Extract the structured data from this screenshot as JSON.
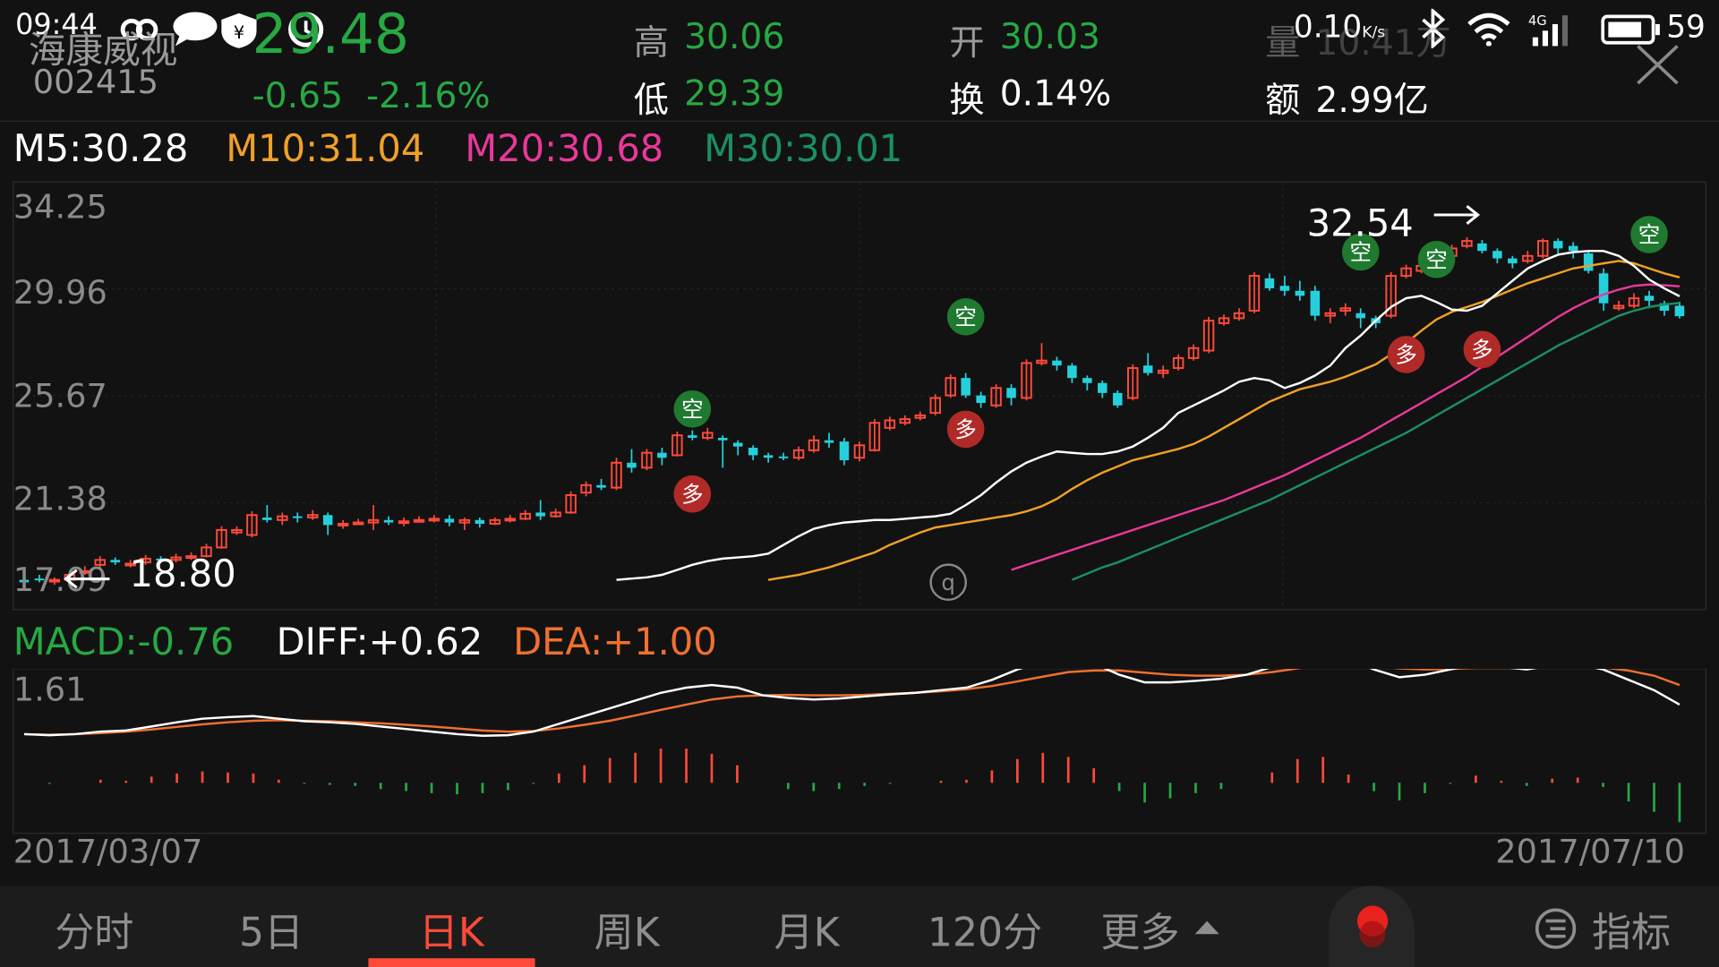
{
  "status_bar": {
    "time": "09:44",
    "net_speed": "0.10",
    "net_unit": "K/s",
    "network": "4G",
    "battery": "59"
  },
  "quote": {
    "name": "海康威视",
    "code": "002415",
    "price": "29.48",
    "change": "-0.65",
    "change_pct": "-2.16%",
    "high_label": "高",
    "high_value": "30.06",
    "low_label": "低",
    "low_value": "29.39",
    "open_label": "开",
    "open_value": "30.03",
    "turnover_label": "换",
    "turnover_value": "0.14%",
    "volume_label": "量",
    "volume_value": "10.41万",
    "amount_label": "额",
    "amount_value": "2.99亿"
  },
  "ma_legend": {
    "ma5": "M5:30.28",
    "ma10": "M10:31.04",
    "ma20": "M20:30.68",
    "ma30": "M30:30.01"
  },
  "colors": {
    "up": "#ff4a3a",
    "down": "#25d0dc",
    "price_green": "#27a844",
    "ma5": "#ffffff",
    "ma10": "#f0a028",
    "ma20": "#e8389a",
    "ma30": "#1a9060",
    "diff": "#ffffff",
    "dea": "#f07030",
    "macd_up": "#ff4a3a",
    "macd_down": "#27a844",
    "background": "#121212"
  },
  "chart_data": [
    {
      "type": "candlestick",
      "title": "",
      "x_start": "2017/03/07",
      "x_end": "2017/07/10",
      "y_ticks": [
        "34.25",
        "29.96",
        "25.67",
        "21.38",
        "17.09"
      ],
      "ylim": [
        17.09,
        34.25
      ],
      "grid": true,
      "max_label": "32.54",
      "min_label": "18.80",
      "candles": [
        [
          18.9,
          18.8,
          19.1,
          18.75
        ],
        [
          18.95,
          18.9,
          19.1,
          18.8
        ],
        [
          18.85,
          18.9,
          19.0,
          18.7
        ],
        [
          18.9,
          19.1,
          19.25,
          18.85
        ],
        [
          19.2,
          19.25,
          19.45,
          19.1
        ],
        [
          19.5,
          19.7,
          19.85,
          19.35
        ],
        [
          19.7,
          19.6,
          19.8,
          19.5
        ],
        [
          19.55,
          19.55,
          19.7,
          19.4
        ],
        [
          19.6,
          19.75,
          19.9,
          19.5
        ],
        [
          19.75,
          19.7,
          19.85,
          19.6
        ],
        [
          19.7,
          19.8,
          19.95,
          19.6
        ],
        [
          19.8,
          19.85,
          20.0,
          19.7
        ],
        [
          19.85,
          20.2,
          20.35,
          19.8
        ],
        [
          20.2,
          20.9,
          21.05,
          20.15
        ],
        [
          20.8,
          20.9,
          21.05,
          20.7
        ],
        [
          20.7,
          21.5,
          21.65,
          20.6
        ],
        [
          21.4,
          21.3,
          21.9,
          21.2
        ],
        [
          21.3,
          21.45,
          21.6,
          21.1
        ],
        [
          21.45,
          21.4,
          21.6,
          21.2
        ],
        [
          21.4,
          21.5,
          21.7,
          21.3
        ],
        [
          21.5,
          21.1,
          21.6,
          20.7
        ],
        [
          21.1,
          21.15,
          21.3,
          20.95
        ],
        [
          21.15,
          21.2,
          21.35,
          21.1
        ],
        [
          21.2,
          21.3,
          21.9,
          20.9
        ],
        [
          21.3,
          21.2,
          21.45,
          21.1
        ],
        [
          21.2,
          21.25,
          21.4,
          21.05
        ],
        [
          21.25,
          21.3,
          21.45,
          21.2
        ],
        [
          21.3,
          21.35,
          21.5,
          21.2
        ],
        [
          21.35,
          21.2,
          21.5,
          21.05
        ],
        [
          21.2,
          21.3,
          21.4,
          20.9
        ],
        [
          21.3,
          21.15,
          21.4,
          21.0
        ],
        [
          21.15,
          21.3,
          21.4,
          21.1
        ],
        [
          21.3,
          21.35,
          21.5,
          21.2
        ],
        [
          21.35,
          21.55,
          21.7,
          21.3
        ],
        [
          21.6,
          21.45,
          22.1,
          21.3
        ],
        [
          21.45,
          21.6,
          21.75,
          21.4
        ],
        [
          21.6,
          22.3,
          22.45,
          21.55
        ],
        [
          22.4,
          22.7,
          22.85,
          22.25
        ],
        [
          22.7,
          22.6,
          22.95,
          22.5
        ],
        [
          22.6,
          23.6,
          23.8,
          22.5
        ],
        [
          23.6,
          23.4,
          24.15,
          23.2
        ],
        [
          23.4,
          24.0,
          24.15,
          23.3
        ],
        [
          24.0,
          23.8,
          24.2,
          23.5
        ],
        [
          23.9,
          24.7,
          24.85,
          23.85
        ],
        [
          24.7,
          24.6,
          24.9,
          24.5
        ],
        [
          24.6,
          24.8,
          25.0,
          24.5
        ],
        [
          24.6,
          24.5,
          24.7,
          23.4
        ],
        [
          24.4,
          24.25,
          24.5,
          23.9
        ],
        [
          24.2,
          23.9,
          24.3,
          23.7
        ],
        [
          23.9,
          23.8,
          24.0,
          23.6
        ],
        [
          23.85,
          23.8,
          24.0,
          23.7
        ],
        [
          23.8,
          24.1,
          24.25,
          23.7
        ],
        [
          24.1,
          24.5,
          24.7,
          24.0
        ],
        [
          24.5,
          24.4,
          24.8,
          24.2
        ],
        [
          24.45,
          23.7,
          24.6,
          23.5
        ],
        [
          23.8,
          24.3,
          24.45,
          23.65
        ],
        [
          24.1,
          25.2,
          25.35,
          24.05
        ],
        [
          25.0,
          25.3,
          25.45,
          24.9
        ],
        [
          25.2,
          25.35,
          25.5,
          25.1
        ],
        [
          25.4,
          25.5,
          25.65,
          25.3
        ],
        [
          25.6,
          26.2,
          26.35,
          25.5
        ],
        [
          26.3,
          27.0,
          27.15,
          26.2
        ],
        [
          27.0,
          26.3,
          27.2,
          26.2
        ],
        [
          26.3,
          26.0,
          26.45,
          25.8
        ],
        [
          25.9,
          26.6,
          26.75,
          25.8
        ],
        [
          26.6,
          26.2,
          26.75,
          25.9
        ],
        [
          26.2,
          27.6,
          27.75,
          26.1
        ],
        [
          27.6,
          27.7,
          28.4,
          27.5
        ],
        [
          27.7,
          27.5,
          27.85,
          27.3
        ],
        [
          27.5,
          27.0,
          27.6,
          26.8
        ],
        [
          27.0,
          26.8,
          27.1,
          26.5
        ],
        [
          26.8,
          26.4,
          26.9,
          26.2
        ],
        [
          26.4,
          25.9,
          26.5,
          25.8
        ],
        [
          26.2,
          27.4,
          27.55,
          26.1
        ],
        [
          27.5,
          27.2,
          28.0,
          27.1
        ],
        [
          27.2,
          27.3,
          27.5,
          27.0
        ],
        [
          27.4,
          27.8,
          27.95,
          27.3
        ],
        [
          27.8,
          28.2,
          28.35,
          27.7
        ],
        [
          28.1,
          29.3,
          29.45,
          28.0
        ],
        [
          29.2,
          29.4,
          29.55,
          29.1
        ],
        [
          29.4,
          29.6,
          29.8,
          29.3
        ],
        [
          29.7,
          31.1,
          31.25,
          29.6
        ],
        [
          31.0,
          30.6,
          31.2,
          30.5
        ],
        [
          30.7,
          30.5,
          31.1,
          30.3
        ],
        [
          30.5,
          30.3,
          30.9,
          30.1
        ],
        [
          30.5,
          29.5,
          30.7,
          29.3
        ],
        [
          29.5,
          29.6,
          29.8,
          29.2
        ],
        [
          29.7,
          29.8,
          30.0,
          29.5
        ],
        [
          29.6,
          29.4,
          29.8,
          29.0
        ],
        [
          29.4,
          29.2,
          29.5,
          29.0
        ],
        [
          29.5,
          31.1,
          31.25,
          29.4
        ],
        [
          31.1,
          31.4,
          31.55,
          31.0
        ],
        [
          31.3,
          31.5,
          31.65,
          31.2
        ],
        [
          31.5,
          31.9,
          32.05,
          31.4
        ],
        [
          31.9,
          32.2,
          32.35,
          31.8
        ],
        [
          32.3,
          32.5,
          32.65,
          32.2
        ],
        [
          32.4,
          32.1,
          32.54,
          32.0
        ],
        [
          32.1,
          31.8,
          32.2,
          31.6
        ],
        [
          31.8,
          31.6,
          31.9,
          31.4
        ],
        [
          31.7,
          31.9,
          32.1,
          31.6
        ],
        [
          31.9,
          32.5,
          32.6,
          31.8
        ],
        [
          32.5,
          32.2,
          32.6,
          32.0
        ],
        [
          32.3,
          32.1,
          32.45,
          31.8
        ],
        [
          32.0,
          31.3,
          32.1,
          31.2
        ],
        [
          31.2,
          30.0,
          31.4,
          29.7
        ],
        [
          29.8,
          29.9,
          30.1,
          29.7
        ],
        [
          29.9,
          30.2,
          30.4,
          29.8
        ],
        [
          30.3,
          30.1,
          30.5,
          29.8
        ],
        [
          30.0,
          29.7,
          30.1,
          29.5
        ],
        [
          29.9,
          29.48,
          30.06,
          29.39
        ]
      ],
      "ma5": [
        18.9,
        18.95,
        19.0,
        19.1,
        19.3,
        19.5,
        19.65,
        19.75,
        19.8,
        19.85,
        19.95,
        20.3,
        20.65,
        20.95,
        21.1,
        21.2,
        21.25,
        21.3,
        21.3,
        21.35,
        21.4,
        21.45,
        21.55,
        21.9,
        22.3,
        22.8,
        23.25,
        23.6,
        23.85,
        24.05,
        24.0,
        23.95,
        23.95,
        24.05,
        24.25,
        24.6,
        25.0,
        25.6,
        25.9,
        26.2,
        26.5,
        26.85,
        27.0,
        26.9,
        26.6,
        26.8,
        27.1,
        27.5,
        28.2,
        28.7,
        29.3,
        29.85,
        30.2,
        30.3,
        30.05,
        29.75,
        29.7,
        29.9,
        30.4,
        30.9,
        31.4,
        31.7,
        31.95,
        32.05,
        32.1,
        32.1,
        31.9,
        31.5,
        30.95,
        30.6,
        30.28
      ],
      "ma10": [
        18.9,
        19.0,
        19.1,
        19.25,
        19.4,
        19.6,
        19.8,
        20.0,
        20.3,
        20.55,
        20.8,
        21.0,
        21.1,
        21.2,
        21.3,
        21.4,
        21.5,
        21.65,
        21.85,
        22.15,
        22.55,
        22.9,
        23.2,
        23.45,
        23.7,
        23.85,
        24.0,
        24.15,
        24.35,
        24.65,
        25.0,
        25.35,
        25.7,
        26.05,
        26.3,
        26.55,
        26.7,
        26.85,
        27.05,
        27.3,
        27.55,
        27.95,
        28.4,
        28.9,
        29.35,
        29.65,
        29.85,
        30.05,
        30.3,
        30.55,
        30.8,
        31.0,
        31.2,
        31.4,
        31.5,
        31.6,
        31.7,
        31.6,
        31.4,
        31.2,
        31.04
      ],
      "ma20": [
        19.3,
        19.5,
        19.7,
        19.9,
        20.1,
        20.3,
        20.5,
        20.7,
        20.9,
        21.1,
        21.3,
        21.5,
        21.7,
        21.9,
        22.1,
        22.35,
        22.6,
        22.85,
        23.1,
        23.4,
        23.7,
        24.0,
        24.3,
        24.6,
        24.95,
        25.3,
        25.65,
        26.0,
        26.35,
        26.7,
        27.05,
        27.45,
        27.85,
        28.25,
        28.65,
        29.05,
        29.45,
        29.8,
        30.1,
        30.35,
        30.55,
        30.7,
        30.75,
        30.72,
        30.68
      ],
      "ma30": [
        18.9,
        19.15,
        19.4,
        19.6,
        19.85,
        20.1,
        20.35,
        20.6,
        20.85,
        21.1,
        21.35,
        21.6,
        21.85,
        22.1,
        22.4,
        22.7,
        23.0,
        23.3,
        23.6,
        23.9,
        24.2,
        24.5,
        24.8,
        25.15,
        25.5,
        25.85,
        26.2,
        26.55,
        26.9,
        27.25,
        27.6,
        27.95,
        28.3,
        28.6,
        28.9,
        29.2,
        29.5,
        29.7,
        29.85,
        29.95,
        30.01
      ],
      "markers": [
        {
          "label": "空",
          "idx": 44,
          "price": 24.7,
          "kind": "sell"
        },
        {
          "label": "多",
          "idx": 44,
          "price": 23.4,
          "kind": "buy"
        },
        {
          "label": "空",
          "idx": 62,
          "price": 28.4,
          "kind": "sell"
        },
        {
          "label": "多",
          "idx": 62,
          "price": 26.0,
          "kind": "buy"
        },
        {
          "label": "空",
          "idx": 88,
          "price": 31.0,
          "kind": "sell"
        },
        {
          "label": "空",
          "idx": 93,
          "price": 30.7,
          "kind": "sell"
        },
        {
          "label": "多",
          "idx": 91,
          "price": 29.0,
          "kind": "buy"
        },
        {
          "label": "多",
          "idx": 96,
          "price": 29.2,
          "kind": "buy"
        },
        {
          "label": "空",
          "idx": 107,
          "price": 31.7,
          "kind": "sell"
        }
      ]
    },
    {
      "type": "line",
      "title": "MACD",
      "macd_label": "MACD:-0.76",
      "diff_label": "DIFF:+0.62",
      "dea_label": "DEA:+1.00",
      "y_top_label": "1.61",
      "diff": [
        0.05,
        0.03,
        0.05,
        0.1,
        0.12,
        0.2,
        0.28,
        0.35,
        0.38,
        0.4,
        0.35,
        0.3,
        0.28,
        0.25,
        0.2,
        0.15,
        0.1,
        0.05,
        0.02,
        0.03,
        0.1,
        0.25,
        0.4,
        0.55,
        0.7,
        0.85,
        0.95,
        1.0,
        0.95,
        0.8,
        0.75,
        0.72,
        0.74,
        0.78,
        0.82,
        0.85,
        0.9,
        0.95,
        1.1,
        1.3,
        1.45,
        1.5,
        1.42,
        1.2,
        1.05,
        1.05,
        1.08,
        1.12,
        1.2,
        1.35,
        1.55,
        1.65,
        1.5,
        1.3,
        1.15,
        1.2,
        1.3,
        1.4,
        1.35,
        1.3,
        1.38,
        1.4,
        1.3,
        1.1,
        0.9,
        0.62
      ],
      "dea": [
        0.05,
        0.04,
        0.05,
        0.07,
        0.1,
        0.14,
        0.19,
        0.24,
        0.28,
        0.31,
        0.32,
        0.31,
        0.3,
        0.28,
        0.26,
        0.23,
        0.2,
        0.16,
        0.12,
        0.1,
        0.11,
        0.16,
        0.23,
        0.31,
        0.41,
        0.52,
        0.62,
        0.72,
        0.78,
        0.8,
        0.81,
        0.8,
        0.8,
        0.81,
        0.83,
        0.85,
        0.88,
        0.92,
        0.98,
        1.07,
        1.16,
        1.25,
        1.28,
        1.28,
        1.24,
        1.2,
        1.18,
        1.18,
        1.2,
        1.25,
        1.32,
        1.4,
        1.42,
        1.38,
        1.32,
        1.3,
        1.31,
        1.33,
        1.33,
        1.33,
        1.34,
        1.35,
        1.34,
        1.28,
        1.18,
        1.0
      ],
      "macd": [
        0,
        -0.02,
        0,
        0.06,
        0.04,
        0.12,
        0.18,
        0.22,
        0.2,
        0.18,
        0.06,
        -0.02,
        -0.04,
        -0.06,
        -0.12,
        -0.16,
        -0.2,
        -0.22,
        -0.2,
        -0.14,
        -0.02,
        0.18,
        0.34,
        0.48,
        0.58,
        0.66,
        0.66,
        0.56,
        0.34,
        0.0,
        -0.12,
        -0.16,
        -0.12,
        -0.06,
        -0.02,
        0.0,
        0.04,
        0.06,
        0.24,
        0.46,
        0.58,
        0.5,
        0.28,
        -0.16,
        -0.38,
        -0.3,
        -0.2,
        -0.12,
        0.0,
        0.2,
        0.46,
        0.5,
        0.16,
        -0.16,
        -0.34,
        -0.2,
        -0.02,
        0.14,
        0.04,
        -0.06,
        0.08,
        0.1,
        -0.08,
        -0.36,
        -0.56,
        -0.76
      ]
    }
  ],
  "tabs": [
    {
      "label": "分时",
      "active": false
    },
    {
      "label": "5日",
      "active": false
    },
    {
      "label": "日K",
      "active": true
    },
    {
      "label": "周K",
      "active": false
    },
    {
      "label": "月K",
      "active": false
    },
    {
      "label": "120分",
      "active": false
    },
    {
      "label": "更多",
      "active": false
    }
  ],
  "indicator_label": "指标"
}
